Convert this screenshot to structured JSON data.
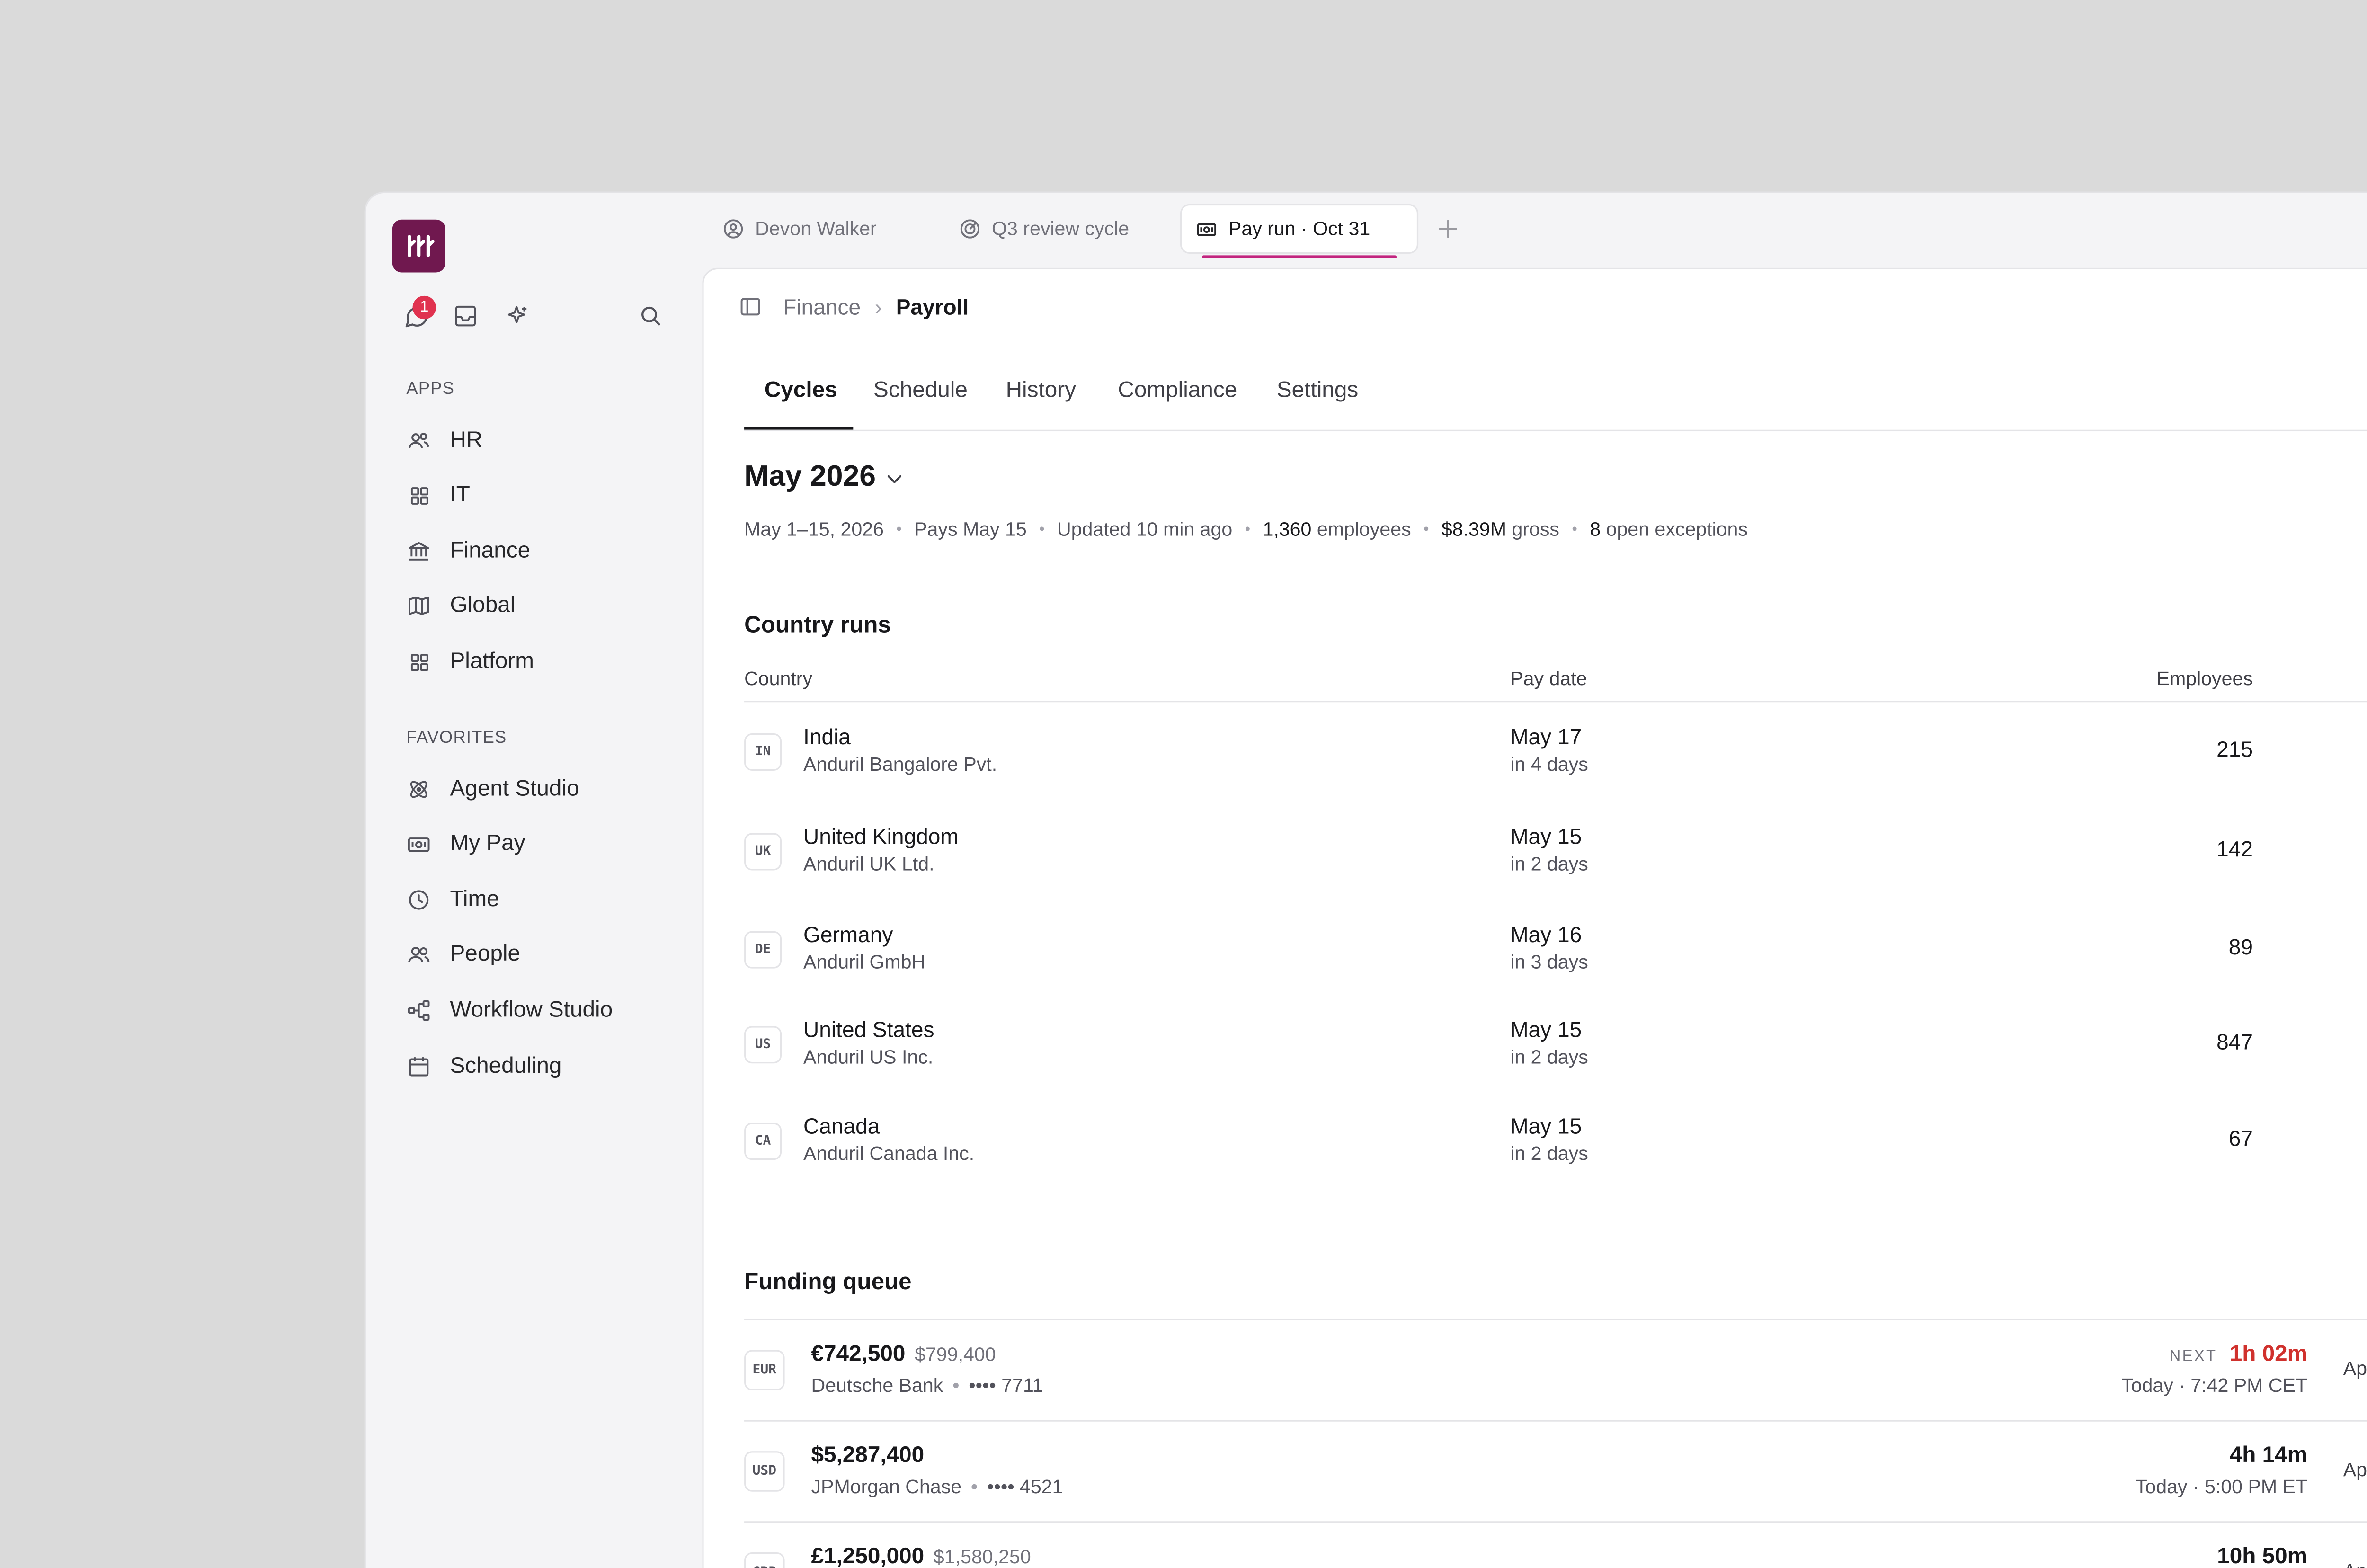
{
  "window_tabs": [
    {
      "label": "Devon Walker",
      "icon": "user-circle-icon"
    },
    {
      "label": "Q3 review cycle",
      "icon": "target-icon"
    },
    {
      "label": "Pay run · Oct 31",
      "icon": "banknote-icon",
      "active": true
    }
  ],
  "sidebar": {
    "notification_count": "1",
    "apps_label": "APPS",
    "apps": [
      {
        "label": "HR",
        "icon": "users-icon"
      },
      {
        "label": "IT",
        "icon": "grid-icon"
      },
      {
        "label": "Finance",
        "icon": "bank-icon"
      },
      {
        "label": "Global",
        "icon": "map-icon"
      },
      {
        "label": "Platform",
        "icon": "grid-icon"
      }
    ],
    "favorites_label": "FAVORITES",
    "favorites": [
      {
        "label": "Agent Studio",
        "icon": "atom-icon"
      },
      {
        "label": "My Pay",
        "icon": "banknote-icon"
      },
      {
        "label": "Time",
        "icon": "clock-icon"
      },
      {
        "label": "People",
        "icon": "people-icon"
      },
      {
        "label": "Workflow Studio",
        "icon": "workflow-icon"
      },
      {
        "label": "Scheduling",
        "icon": "calendar-icon"
      }
    ]
  },
  "breadcrumb": {
    "parent": "Finance",
    "current": "Payroll"
  },
  "page_tabs": [
    "Cycles",
    "Schedule",
    "History",
    "Compliance",
    "Settings"
  ],
  "active_page_tab": "Cycles",
  "period": {
    "title": "May 2026",
    "range": "May 1–15, 2026",
    "pays": "Pays May 15",
    "updated": "Updated 10 min ago",
    "employees_count": "1,360",
    "employees_label": "employees",
    "gross_amount": "$8.39M",
    "gross_label": "gross",
    "exceptions_count": "8",
    "exceptions_label": "open exceptions"
  },
  "country_runs": {
    "title": "Country runs",
    "columns": {
      "country": "Country",
      "pay_date": "Pay date",
      "employees": "Employees"
    },
    "rows": [
      {
        "code": "IN",
        "country": "India",
        "entity": "Anduril Bangalore Pvt.",
        "pay_date": "May 17",
        "relative": "in 4 days",
        "employees": "215"
      },
      {
        "code": "UK",
        "country": "United Kingdom",
        "entity": "Anduril UK Ltd.",
        "pay_date": "May 15",
        "relative": "in 2 days",
        "employees": "142"
      },
      {
        "code": "DE",
        "country": "Germany",
        "entity": "Anduril GmbH",
        "pay_date": "May 16",
        "relative": "in 3 days",
        "employees": "89"
      },
      {
        "code": "US",
        "country": "United States",
        "entity": "Anduril US Inc.",
        "pay_date": "May 15",
        "relative": "in 2 days",
        "employees": "847"
      },
      {
        "code": "CA",
        "country": "Canada",
        "entity": "Anduril Canada Inc.",
        "pay_date": "May 15",
        "relative": "in 2 days",
        "employees": "67"
      }
    ]
  },
  "funding_queue": {
    "title": "Funding queue",
    "next_label": "NEXT",
    "approve_label": "Approve →",
    "rows": [
      {
        "currency": "EUR",
        "amount": "€742,500",
        "converted": "$799,400",
        "bank": "Deutsche Bank",
        "account": "•••• 7711",
        "countdown": "1h 02m",
        "when": "Today · 7:42 PM CET",
        "next": true
      },
      {
        "currency": "USD",
        "amount": "$5,287,400",
        "converted": "",
        "bank": "JPMorgan Chase",
        "account": "•••• 4521",
        "countdown": "4h 14m",
        "when": "Today · 5:00 PM ET",
        "next": false
      },
      {
        "currency": "GBP",
        "amount": "£1,250,000",
        "converted": "$1,580,250",
        "bank": "",
        "account": "",
        "countdown": "10h 50m",
        "when": "",
        "next": false
      }
    ]
  },
  "colors": {
    "brand": "#70184f",
    "tab_accent": "#c2257f",
    "urgent": "#d0312d",
    "badge": "#e0324f"
  }
}
